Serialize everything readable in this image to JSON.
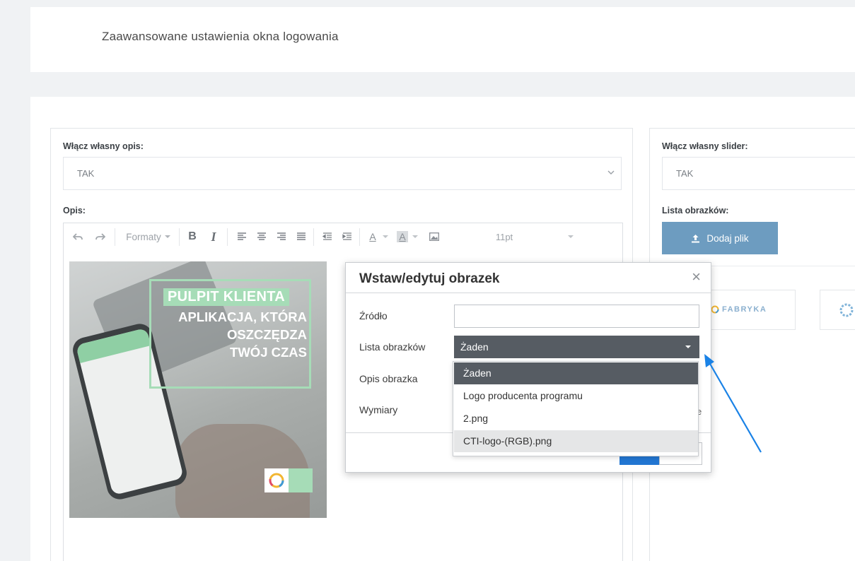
{
  "header": {
    "title": "Zaawansowane ustawienia okna logowania"
  },
  "left_panel": {
    "description_toggle_label": "Włącz własny opis:",
    "description_toggle_value": "TAK",
    "description_label": "Opis:",
    "toolbar": {
      "formats_label": "Formaty",
      "bold": "B",
      "italic": "I",
      "font_color": "A",
      "bg_color": "A",
      "font_size": "11pt"
    },
    "promo_image": {
      "line1": "PULPIT KLIENTA",
      "line2": "APLIKACJA, KTÓRA",
      "line3": "OSZCZĘDZA",
      "line4": "TWÓJ CZAS"
    }
  },
  "right_panel": {
    "slider_toggle_label": "Włącz własny slider:",
    "slider_toggle_value": "TAK",
    "image_list_label": "Lista obrazków:",
    "upload_button": "Dodaj plik",
    "thumb_logo_text": "FABRYKA"
  },
  "modal": {
    "title": "Wstaw/edytuj obrazek",
    "source_label": "Źródło",
    "source_value": "",
    "image_list_label": "Lista obrazków",
    "image_list_value": "Żaden",
    "description_label": "Opis obrazka",
    "dimensions_label": "Wymiary",
    "right_hint": "e"
  },
  "dropdown": {
    "options": [
      "Żaden",
      "Logo producenta programu",
      "2.png",
      "CTI-logo-(RGB).png"
    ],
    "selected_index": 0,
    "hovered_index": 3
  },
  "colors": {
    "accent": "#6d9cc0",
    "select_bg": "#565c63",
    "promo_green": "#a6dcb7",
    "arrow": "#1a82e6"
  }
}
